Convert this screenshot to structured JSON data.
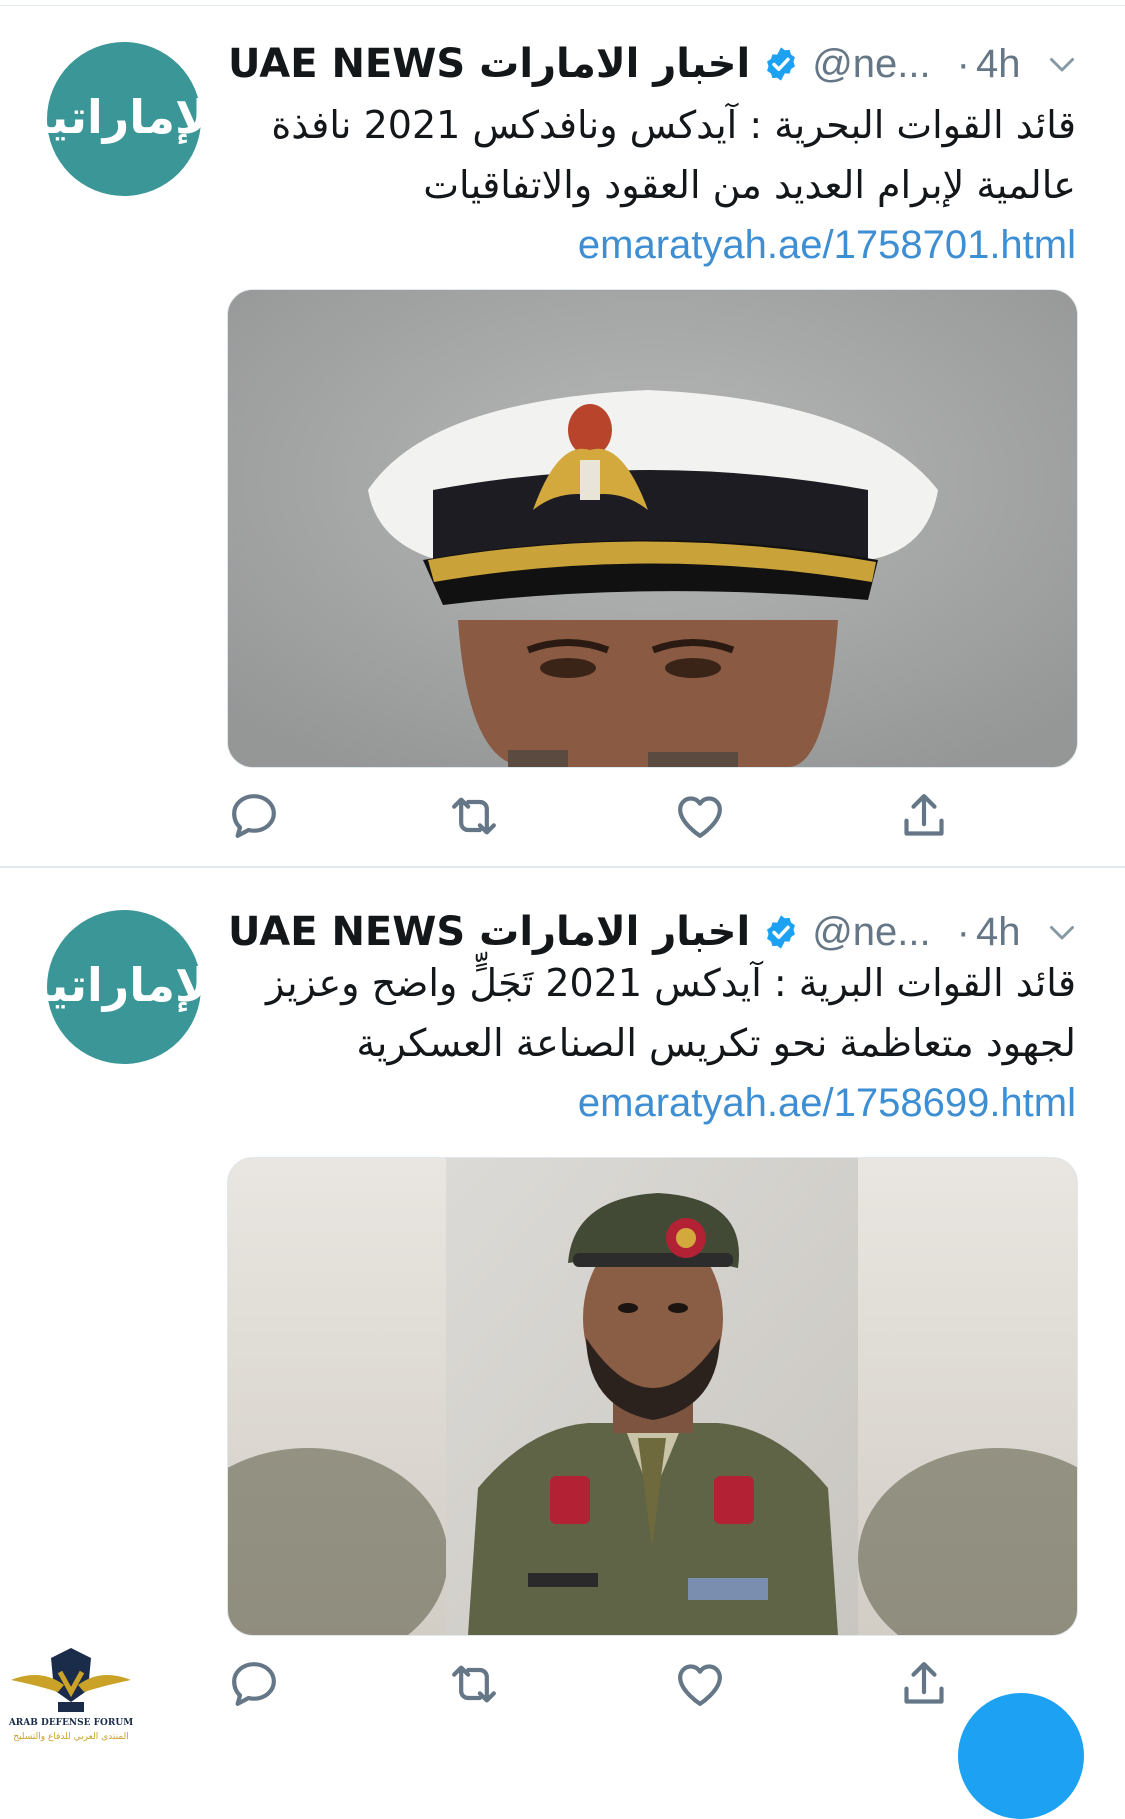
{
  "tweets": [
    {
      "avatar_text": "الإماراتية",
      "display_name": "UAE NEWS اخبار الامارات",
      "handle": "@ne...",
      "separator": "·",
      "time": "4h",
      "text": "قائد القوات البحرية : آيدكس ونافدكس 2021 نافذة عالمية لإبرام العديد من العقود والاتفاقيات",
      "link": "emaratyah.ae/1758701.html",
      "media_alt": "Naval commander in white peaked cap with gold insignia"
    },
    {
      "avatar_text": "الإماراتية",
      "display_name": "UAE NEWS اخبار الامارات",
      "handle": "@ne...",
      "separator": "·",
      "time": "4h",
      "text": "قائد القوات البرية : آيدكس 2021 تَجَلٍّ واضح وعزيز لجهود متعاظمة نحو تكريس الصناعة العسكرية",
      "link": "emaratyah.ae/1758699.html",
      "media_alt": "Land forces commander in green beret and olive uniform"
    }
  ],
  "watermark": {
    "title": "ARAB DEFENSE FORUM",
    "subtitle": "المنتدى العربي للدفاع والتسليح"
  },
  "icons": {
    "verified": "verified-badge-icon",
    "caret": "chevron-down-icon",
    "reply": "reply-icon",
    "retweet": "retweet-icon",
    "like": "heart-icon",
    "share": "share-icon"
  },
  "colors": {
    "avatar": "#3b9697",
    "link": "#3d8ed3",
    "verified": "#1da1f2",
    "muted": "#657786",
    "fab": "#1da1f2"
  }
}
